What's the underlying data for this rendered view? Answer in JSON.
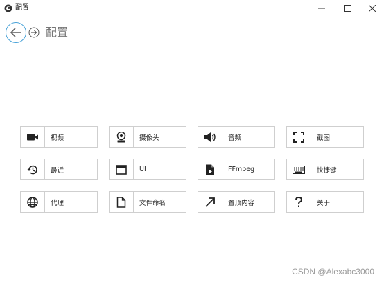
{
  "window": {
    "title": "配置",
    "controls": {
      "minimize": "minimize",
      "maximize": "maximize",
      "close": "close"
    }
  },
  "header": {
    "page_title": "配置",
    "accent_color": "#4aa3d8"
  },
  "tiles": [
    {
      "label": "视频",
      "icon": "video-camera-icon"
    },
    {
      "label": "摄像头",
      "icon": "webcam-icon"
    },
    {
      "label": "音频",
      "icon": "speaker-icon"
    },
    {
      "label": "截图",
      "icon": "screenshot-frame-icon"
    },
    {
      "label": "最近",
      "icon": "history-icon"
    },
    {
      "label": "UI",
      "icon": "window-ui-icon"
    },
    {
      "label": "FFmpeg",
      "icon": "media-file-icon"
    },
    {
      "label": "快捷键",
      "icon": "keyboard-icon"
    },
    {
      "label": "代理",
      "icon": "globe-icon"
    },
    {
      "label": "文件命名",
      "icon": "document-icon"
    },
    {
      "label": "置顶内容",
      "icon": "arrow-up-right-icon"
    },
    {
      "label": "关于",
      "icon": "question-mark-icon"
    }
  ],
  "watermark": "CSDN @Alexabc3000"
}
